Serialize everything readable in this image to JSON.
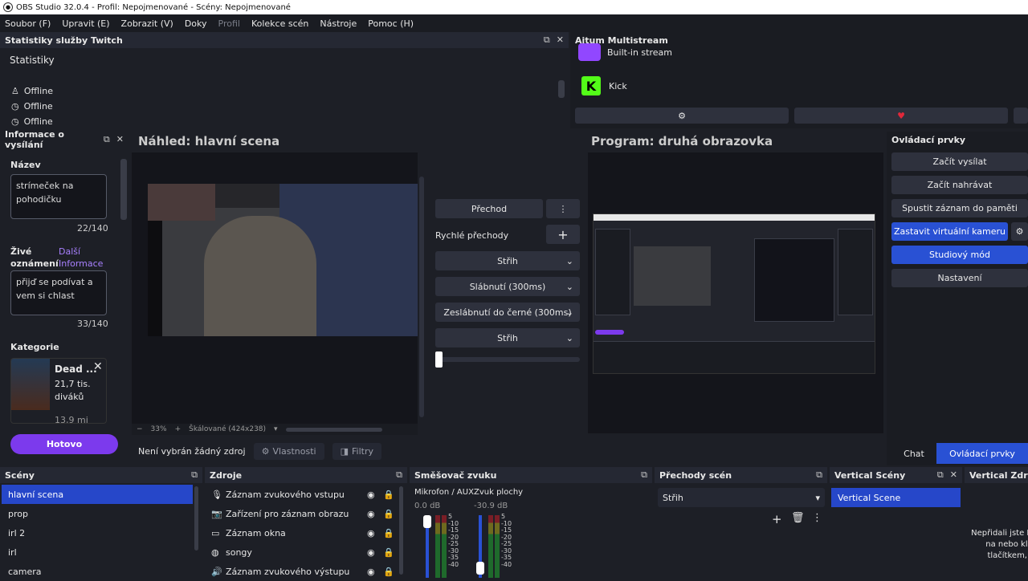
{
  "titlebar": {
    "title": "OBS Studio 32.0.4 - Profil: Nepojmenované - Scény: Nepojmenované"
  },
  "menu": [
    "Soubor (F)",
    "Upravit (E)",
    "Zobrazit (V)",
    "Doky",
    "Profil",
    "Kolekce scén",
    "Nástroje",
    "Pomoc (H)"
  ],
  "twitch_stats": {
    "title": "Statistiky služby Twitch",
    "tab": "Statistiky",
    "rows": [
      "Offline",
      "Offline",
      "Offline"
    ]
  },
  "multistream": {
    "title": "Aitum Multistream",
    "item1": "Built-in stream",
    "item2": "Kick"
  },
  "stream_info": {
    "title": "Informace o vysílání",
    "name_label": "Název",
    "name_value": "strímeček na pohodičku",
    "name_count": "22/140",
    "live_label": "Živé oznámení",
    "more_link": "Další Informace",
    "live_value": "přijď se podívat a vem si chlast",
    "live_count": "33/140",
    "category_label": "Kategorie",
    "category_name": "Dead ...",
    "category_viewers": "21,7 tis. diváků",
    "category_followers": "13,9 mi",
    "done_button": "Hotovo"
  },
  "preview": {
    "title": "Náhled: hlavní scena",
    "zoom": "33%",
    "scale": "Škálované (424x238)"
  },
  "program": {
    "title": "Program: druhá obrazovka"
  },
  "transitions": {
    "transition_button": "Přechod",
    "quick_label": "Rychlé přechody",
    "items": [
      "Střih",
      "Slábnutí (300ms)",
      "Zeslábnutí do černé (300ms)",
      "Střih"
    ]
  },
  "source_toolbar": {
    "no_source": "Není vybrán žádný zdroj",
    "properties": "Vlastnosti",
    "filters": "Filtry"
  },
  "controls": {
    "title": "Ovládací prvky",
    "buttons": [
      "Začít vysílat",
      "Začít nahrávat",
      "Spustit záznam do paměti",
      "Zastavit virtuální kameru",
      "Studiový mód",
      "Nastavení"
    ],
    "tab_chat": "Chat",
    "tab_controls": "Ovládací prvky"
  },
  "scenes": {
    "title": "Scény",
    "items": [
      "hlavní scena",
      "prop",
      "irl 2",
      "irl",
      "camera"
    ]
  },
  "sources": {
    "title": "Zdroje",
    "items": [
      "Záznam zvukového vstupu",
      "Zařízení pro záznam obrazu",
      "Záznam okna",
      "songy",
      "Záznam zvukového výstupu"
    ]
  },
  "mixer": {
    "title": "Směšovač zvuku",
    "ch1_name": "Mikrofon / AUX",
    "ch1_db": "0.0 dB",
    "ch2_name": "Zvuk plochy",
    "ch2_db": "-30.9 dB",
    "scale": [
      "5",
      "-10",
      "-15",
      "-20",
      "-25",
      "-30",
      "-35",
      "-40"
    ]
  },
  "scene_transitions": {
    "title": "Přechody scén",
    "selected": "Střih"
  },
  "vertical_scenes": {
    "title": "Vertical Scény",
    "item": "Vertical Scene"
  },
  "vertical_sources": {
    "title": "Vertical Zdroje",
    "empty_text": "Nepřidali jste Klikněte na nebo klikně tlačítkem, pro"
  },
  "colors": {
    "accent": "#2951d4",
    "twitch": "#9147ff",
    "kick": "#53fc18"
  }
}
